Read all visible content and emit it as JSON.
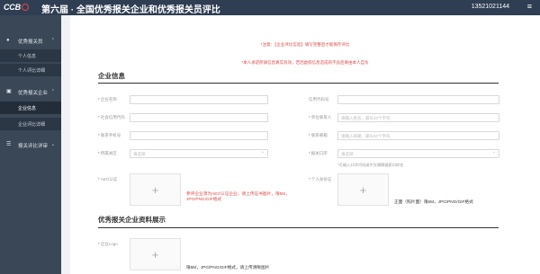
{
  "header": {
    "logo": "CCB",
    "title": "第六届 · 全国优秀报关企业和优秀报关员评比",
    "phone": "13521021144",
    "menu_icon": "hamburger-icon"
  },
  "sidebar": {
    "groups": [
      {
        "icon": "user-icon",
        "label": "优秀报关员",
        "subitems": [
          {
            "label": "个人信息"
          },
          {
            "label": "个人评比详细"
          }
        ]
      },
      {
        "icon": "building-icon",
        "label": "优秀报关企业",
        "subitems": [
          {
            "label": "企业信息"
          },
          {
            "label": "企业评比详细"
          }
        ]
      },
      {
        "icon": "list-icon",
        "label": "报关评比详审",
        "subitems": []
      }
    ]
  },
  "notices": [
    "*注意：【企业评比信息】填写完整后才能保存评比",
    "*本人承诺所填信息真实有效，若因虚假信息造成的不良后果由本人自负"
  ],
  "section1": {
    "title": "企业信息",
    "fields": {
      "company_name": {
        "label": "企业名称",
        "placeholder": ""
      },
      "credit_code": {
        "label": "信用代码号",
        "placeholder": ""
      },
      "social_credit": {
        "label": "社会信用代码",
        "placeholder": ""
      },
      "contact_person": {
        "label": "单位联系人",
        "placeholder": "请输入姓名，最长20个字符"
      },
      "contact_phone": {
        "label": "联系手机号",
        "placeholder": ""
      },
      "contact_email": {
        "label": "联系邮箱",
        "placeholder": "请输入邮箱，最长50个字符"
      },
      "region": {
        "label": "所属关区",
        "placeholder": "请选择"
      },
      "customs_port": {
        "label": "报关口岸",
        "placeholder": "请选择"
      },
      "port_hint": "*可输入12字代码或中文模糊搜索口岸名",
      "aeo": {
        "label": "AEO认证",
        "note": "参评企业须为AEO认证企业，请上传证书图片，限5M，JPG/PNG/GIF格式"
      },
      "person_cert": {
        "label": "个人身份证",
        "note": "正面（照片面）限5M，JPG/PNG/GIF格式"
      }
    }
  },
  "section2": {
    "title": "优秀报关企业资料展示",
    "logo_upload": {
      "label": "企业Logo",
      "note": "限5M，JPG/PNG/GIF格式，请上传清晰图片"
    }
  }
}
